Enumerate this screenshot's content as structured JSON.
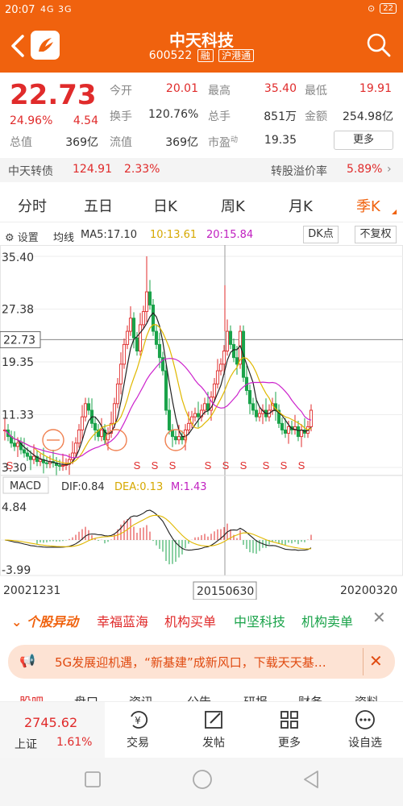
{
  "status": {
    "time": "20:07",
    "signal": "4G 3G",
    "battery": "22"
  },
  "header": {
    "title": "中天科技",
    "code": "600522",
    "tag1": "融",
    "tag2": "沪港通"
  },
  "quote": {
    "price": "22.73",
    "change_pct": "24.96%",
    "change": "4.54",
    "open_label": "今开",
    "open": "20.01",
    "high_label": "最高",
    "high": "35.40",
    "low_label": "最低",
    "low": "19.91",
    "turnover_label": "换手",
    "turnover": "120.76%",
    "volume_label": "总手",
    "volume": "851万",
    "amount_label": "金额",
    "amount": "254.98亿",
    "mktcap_label": "总值",
    "mktcap": "369亿",
    "float_label": "流值",
    "float": "369亿",
    "pe_label": "市盈",
    "pe_sup": "动",
    "pe": "19.35",
    "more": "更多"
  },
  "bond": {
    "name": "中天转债",
    "price": "124.91",
    "pct": "2.33%",
    "premium_label": "转股溢价率",
    "premium": "5.89%"
  },
  "tabs": [
    "分时",
    "五日",
    "日K",
    "周K",
    "月K",
    "季K"
  ],
  "toolbar": {
    "settings": "设置",
    "ma_label": "均线",
    "ma5": "MA5:17.10",
    "ma10": "10:13.61",
    "ma20": "20:15.84",
    "dk": "DK点",
    "fq": "不复权"
  },
  "chart_data": {
    "type": "candlestick",
    "y_labels": [
      "35.40",
      "27.38",
      "22.73",
      "19.35",
      "11.33",
      "3.30"
    ],
    "ylim": [
      3.3,
      35.4
    ],
    "current_price_label": "22.73",
    "x_labels": [
      "20021231",
      "20150630",
      "20200320"
    ],
    "signal_marker": "S",
    "macd": {
      "label": "MACD",
      "dif": "DIF:0.84",
      "dea": "DEA:0.13",
      "m": "M:1.43",
      "y_top": "4.84",
      "y_bottom": "-3.99"
    }
  },
  "ticker": {
    "title": "个股异动",
    "items": [
      "幸福蓝海",
      "机构买单",
      "中坚科技",
      "机构卖单"
    ]
  },
  "banner": {
    "text": "5G发展迎机遇，“新基建”成新风口，下载天天基…"
  },
  "subtabs": [
    "股吧",
    "盘口",
    "资讯",
    "公告",
    "研报",
    "财务",
    "资料"
  ],
  "bottom": {
    "index_value": "2745.62",
    "index_name": "上证",
    "index_pct": "1.61%",
    "items": [
      "交易",
      "发帖",
      "更多",
      "设自选"
    ]
  }
}
